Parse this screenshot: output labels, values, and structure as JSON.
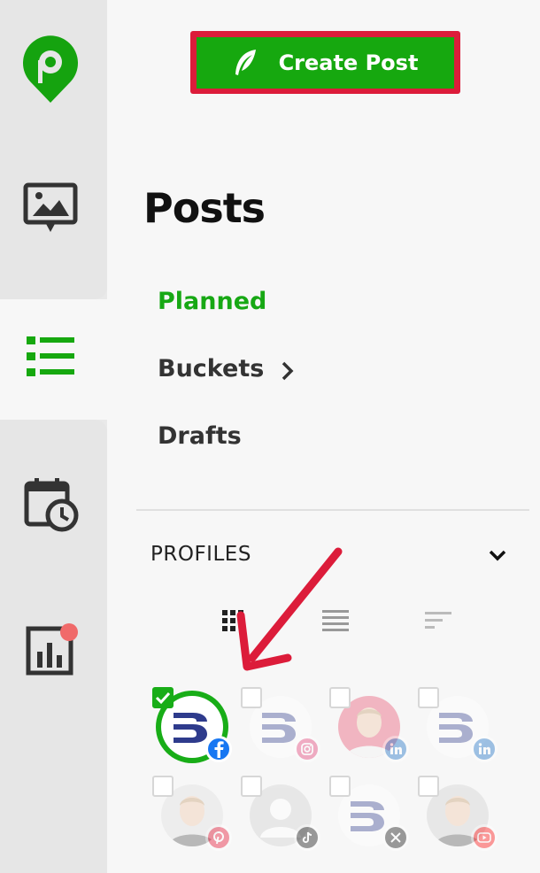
{
  "header": {
    "create_label": "Create Post"
  },
  "page_title": "Posts",
  "nav": {
    "items": [
      {
        "label": "Planned",
        "active": true
      },
      {
        "label": "Buckets",
        "has_submenu": true
      },
      {
        "label": "Drafts"
      }
    ]
  },
  "profiles": {
    "label": "PROFILES",
    "view_modes": [
      "grid-view-icon",
      "list-view-icon",
      "sort-view-icon"
    ],
    "active_view": "grid",
    "items": [
      {
        "name": "company-logo",
        "network": "facebook",
        "selected": true
      },
      {
        "name": "company-logo",
        "network": "instagram",
        "selected": false
      },
      {
        "name": "person-photo",
        "network": "linkedin",
        "selected": false
      },
      {
        "name": "company-logo",
        "network": "linkedin",
        "selected": false
      },
      {
        "name": "person-photo",
        "network": "pinterest",
        "selected": false
      },
      {
        "name": "default-avatar",
        "network": "tiktok",
        "selected": false
      },
      {
        "name": "company-logo",
        "network": "x",
        "selected": false
      },
      {
        "name": "person-photo",
        "network": "youtube",
        "selected": false
      }
    ]
  },
  "colors": {
    "brand_green": "#16a80f",
    "highlight_red": "#dc1c3a",
    "notification_dot": "#f06a6a"
  }
}
